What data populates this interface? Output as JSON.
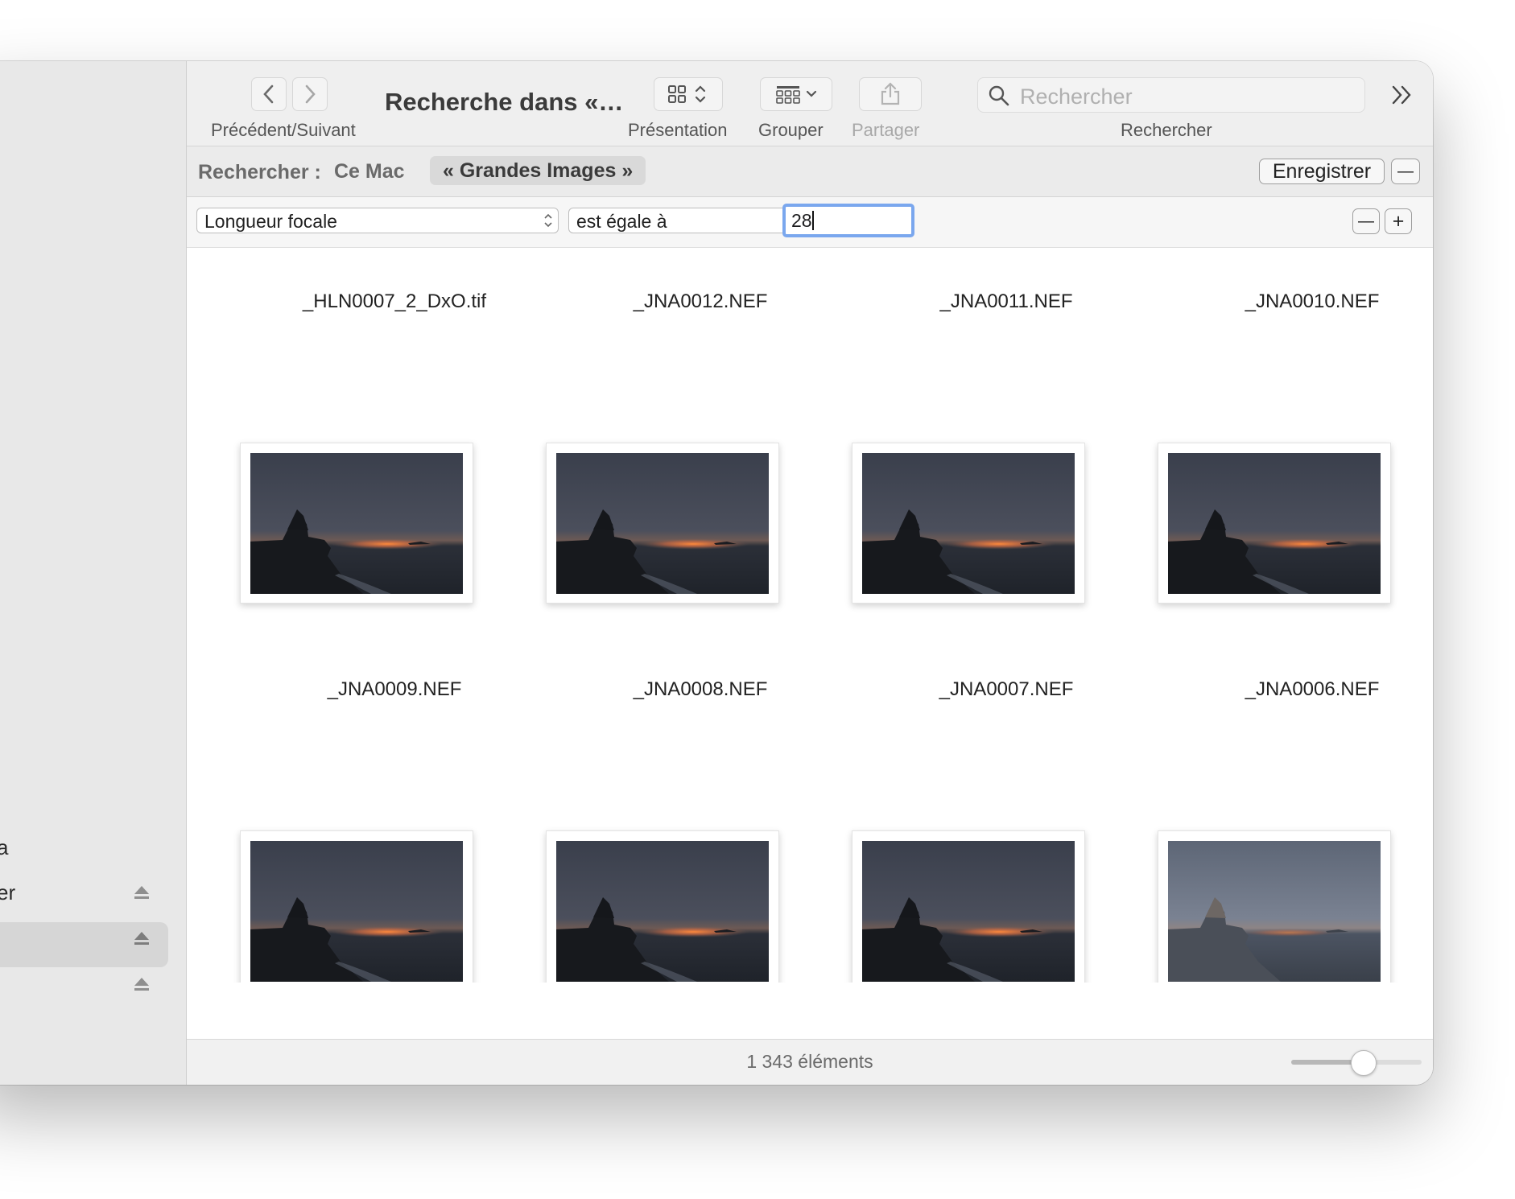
{
  "window": {
    "title": "Recherche dans «…"
  },
  "sidebar": {
    "items": [
      {
        "label": "a",
        "eject": false
      },
      {
        "label": "er",
        "eject": true
      },
      {
        "label": "",
        "eject": true,
        "selected": true
      },
      {
        "label": "",
        "eject": true
      }
    ]
  },
  "toolbar": {
    "nav_label": "Précédent/Suivant",
    "view_label": "Présentation",
    "group_label": "Grouper",
    "share_label": "Partager",
    "search_label": "Rechercher",
    "search_placeholder": "Rechercher",
    "icons": {
      "back": "chevron-left-icon",
      "forward": "chevron-right-icon",
      "view": "grid-view-icon",
      "group": "group-icon",
      "share": "share-icon",
      "search": "magnifier-icon",
      "overflow": "double-chevron-right-icon"
    }
  },
  "scope": {
    "label": "Rechercher :",
    "this_mac": "Ce Mac",
    "selected": "« Grandes Images »",
    "save_button": "Enregistrer",
    "remove_button": "—"
  },
  "criteria": {
    "attribute": "Longueur focale",
    "operator": "est égale à",
    "value": "28",
    "remove": "—",
    "add": "+"
  },
  "files": {
    "row1": [
      "_HLN0007_2_DxO.tif",
      "_JNA0012.NEF",
      "_JNA0011.NEF",
      "_JNA0010.NEF"
    ],
    "row2": [
      "_JNA0009.NEF",
      "_JNA0008.NEF",
      "_JNA0007.NEF",
      "_JNA0006.NEF"
    ]
  },
  "status": {
    "count": "1 343 éléments",
    "icon_size_level": 0.55
  },
  "colors": {
    "accent_focus": "#7aa7ee",
    "sidebar_bg": "#e8e8e8",
    "toolbar_bg": "#efefef"
  }
}
